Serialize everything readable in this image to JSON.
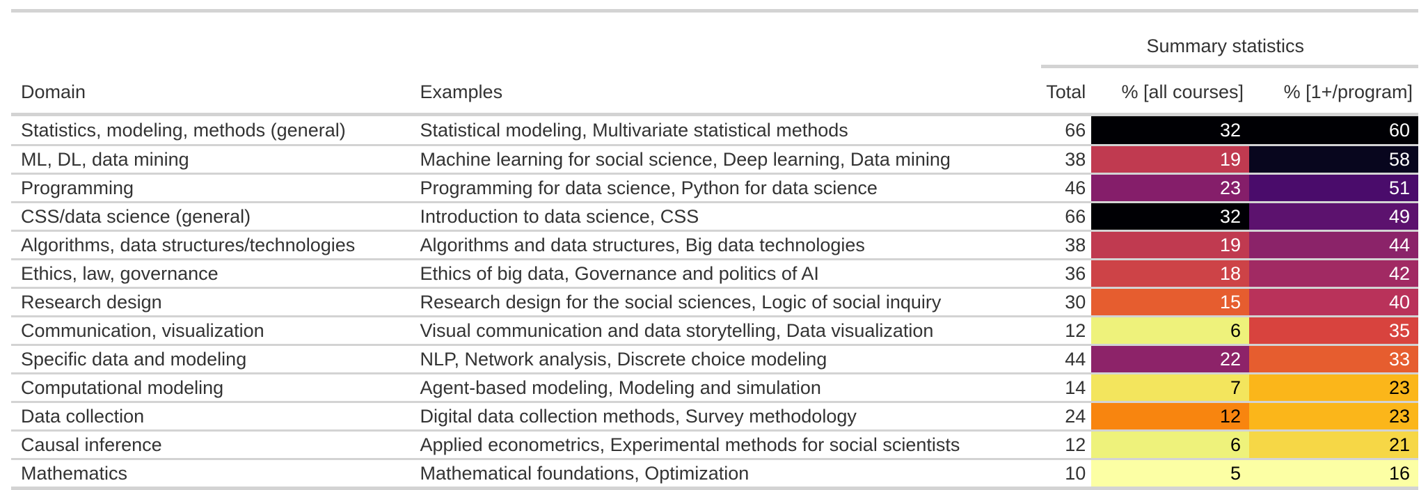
{
  "header": {
    "spanner": "Summary statistics",
    "columns": {
      "domain": "Domain",
      "examples": "Examples",
      "total": "Total",
      "pct_all": "% [all courses]",
      "pct_program": "% [1+/program]"
    }
  },
  "rows": [
    {
      "domain": "Statistics, modeling, methods (general)",
      "examples": "Statistical modeling, Multivariate statistical methods",
      "total": "66",
      "pct_all": "32",
      "pct_program": "60",
      "pct_all_color": "#000004",
      "pct_all_text": "#ffffff",
      "pct_program_color": "#000004",
      "pct_program_text": "#ffffff"
    },
    {
      "domain": "ML, DL, data mining",
      "examples": "Machine learning for social science, Deep learning, Data mining",
      "total": "38",
      "pct_all": "19",
      "pct_program": "58",
      "pct_all_color": "#c03a50",
      "pct_all_text": "#ffffff",
      "pct_program_color": "#08061e",
      "pct_program_text": "#ffffff"
    },
    {
      "domain": "Programming",
      "examples": "Programming for data science, Python for data science",
      "total": "46",
      "pct_all": "23",
      "pct_program": "51",
      "pct_all_color": "#851e6a",
      "pct_all_text": "#ffffff",
      "pct_program_color": "#4a0c6b",
      "pct_program_text": "#ffffff"
    },
    {
      "domain": "CSS/data science (general)",
      "examples": "Introduction to data science, CSS",
      "total": "66",
      "pct_all": "32",
      "pct_program": "49",
      "pct_all_color": "#000004",
      "pct_all_text": "#ffffff",
      "pct_program_color": "#5c126e",
      "pct_program_text": "#ffffff"
    },
    {
      "domain": "Algorithms, data structures/technologies",
      "examples": "Algorithms and data structures, Big data technologies",
      "total": "38",
      "pct_all": "19",
      "pct_program": "44",
      "pct_all_color": "#c03a50",
      "pct_all_text": "#ffffff",
      "pct_program_color": "#8b2369",
      "pct_program_text": "#ffffff"
    },
    {
      "domain": "Ethics, law, governance",
      "examples": "Ethics of big data, Governance and politics of AI",
      "total": "36",
      "pct_all": "18",
      "pct_program": "42",
      "pct_all_color": "#cd4347",
      "pct_all_text": "#ffffff",
      "pct_program_color": "#a12a63",
      "pct_program_text": "#ffffff"
    },
    {
      "domain": "Research design",
      "examples": "Research design for the social sciences, Logic of social inquiry",
      "total": "30",
      "pct_all": "15",
      "pct_program": "40",
      "pct_all_color": "#e65d2f",
      "pct_all_text": "#ffffff",
      "pct_program_color": "#b9325a",
      "pct_program_text": "#ffffff"
    },
    {
      "domain": "Communication, visualization",
      "examples": "Visual communication and data storytelling, Data visualization",
      "total": "12",
      "pct_all": "6",
      "pct_program": "35",
      "pct_all_color": "#eef27b",
      "pct_all_text": "#000000",
      "pct_program_color": "#d8433e",
      "pct_program_text": "#ffffff"
    },
    {
      "domain": "Specific data and modeling",
      "examples": "NLP, Network analysis, Discrete choice modeling",
      "total": "44",
      "pct_all": "22",
      "pct_program": "33",
      "pct_all_color": "#8d2369",
      "pct_all_text": "#ffffff",
      "pct_program_color": "#e65d2f",
      "pct_program_text": "#ffffff"
    },
    {
      "domain": "Computational modeling",
      "examples": "Agent-based modeling, Modeling and simulation",
      "total": "14",
      "pct_all": "7",
      "pct_program": "23",
      "pct_all_color": "#f3e55d",
      "pct_all_text": "#000000",
      "pct_program_color": "#fbb61a",
      "pct_program_text": "#000000"
    },
    {
      "domain": "Data collection",
      "examples": "Digital data collection methods, Survey methodology",
      "total": "24",
      "pct_all": "12",
      "pct_program": "23",
      "pct_all_color": "#f8850f",
      "pct_all_text": "#000000",
      "pct_program_color": "#fbb61a",
      "pct_program_text": "#000000"
    },
    {
      "domain": "Causal inference",
      "examples": "Applied econometrics, Experimental methods for social scientists",
      "total": "12",
      "pct_all": "6",
      "pct_program": "21",
      "pct_all_color": "#eef27b",
      "pct_all_text": "#000000",
      "pct_program_color": "#f6d746",
      "pct_program_text": "#000000"
    },
    {
      "domain": "Mathematics",
      "examples": "Mathematical foundations, Optimization",
      "total": "10",
      "pct_all": "5",
      "pct_program": "16",
      "pct_all_color": "#fcffa4",
      "pct_all_text": "#000000",
      "pct_program_color": "#fcffa4",
      "pct_program_text": "#000000"
    }
  ]
}
